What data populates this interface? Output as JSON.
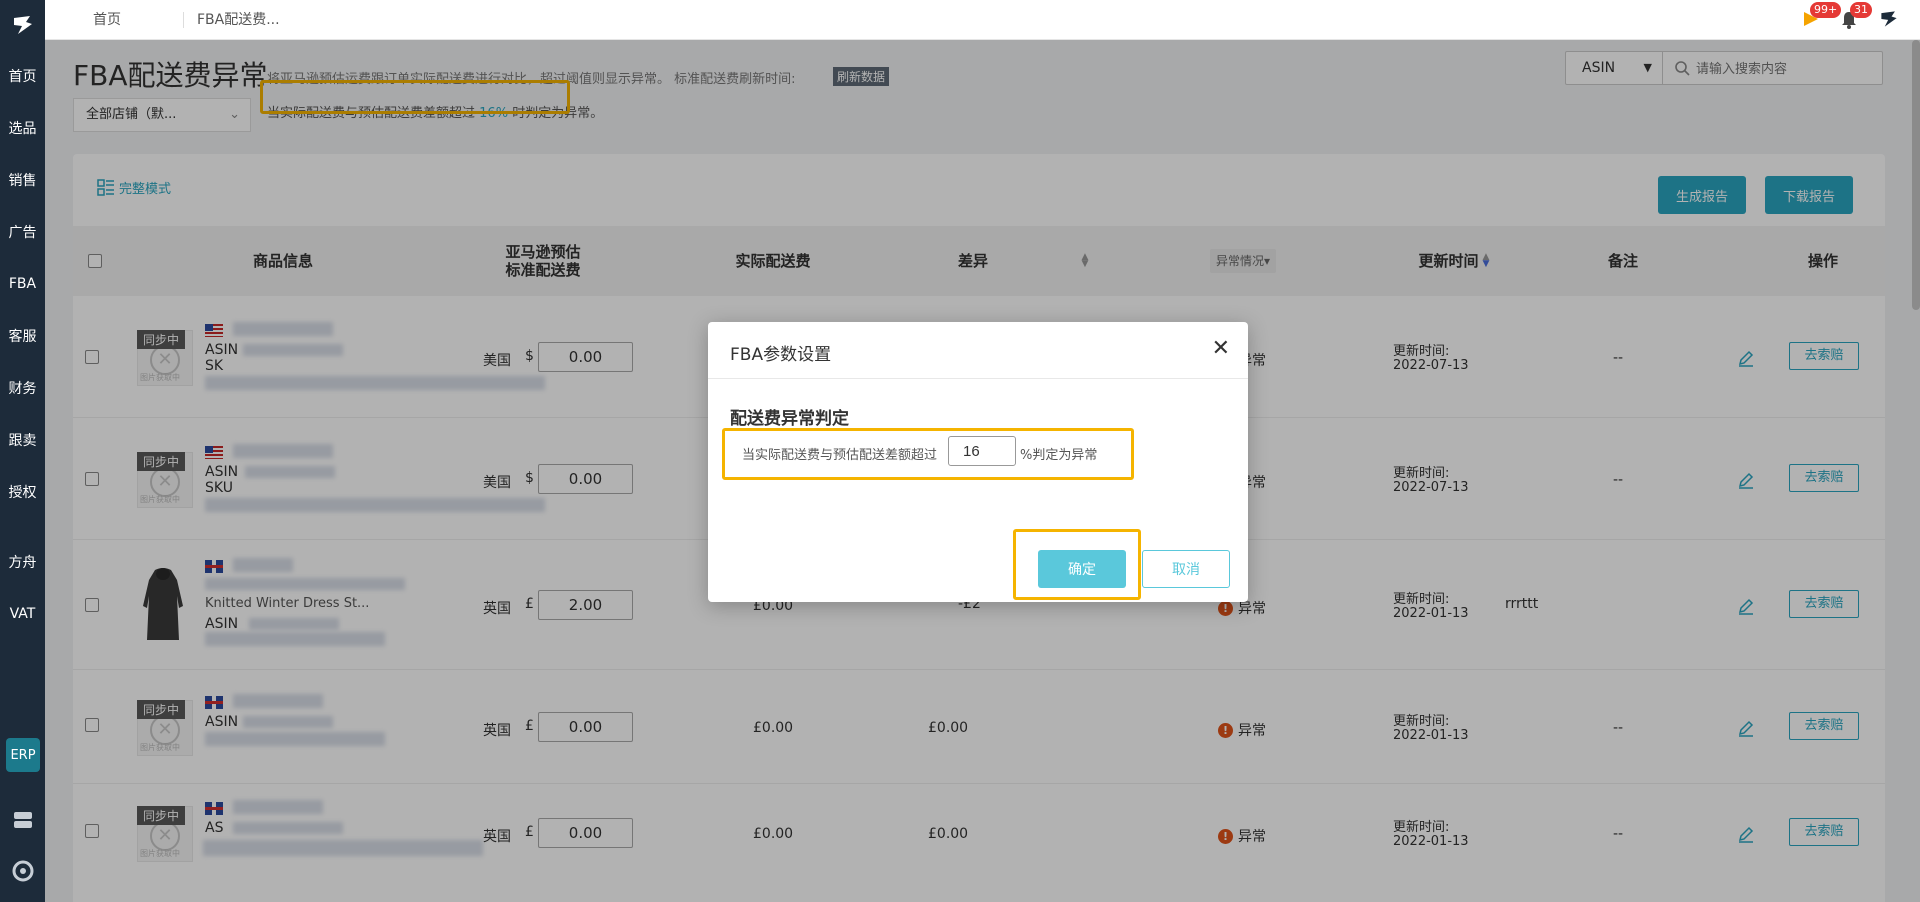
{
  "sidebar": {
    "items": [
      "首页",
      "选品",
      "销售",
      "广告",
      "FBA",
      "客服",
      "财务",
      "跟卖",
      "授权",
      "方舟",
      "VAT"
    ],
    "erp": "ERP"
  },
  "topbar": {
    "tabs": [
      "首页",
      "FBA配送费..."
    ],
    "flag_badge": "99+",
    "bell_badge": "31"
  },
  "page": {
    "title": "FBA配送费异常",
    "description": "将亚马逊预估运费跟订单实际配送费进行对比，超过阈值则显示异常。 标准配送费刷新时间:",
    "refresh_label": "刷新数据",
    "store_select": "全部店铺（默...",
    "hint_prefix": "当实际配送费与预估配送费差额超过",
    "hint_pct": "16%",
    "hint_suffix": "时判定为异常。"
  },
  "search": {
    "field": "ASIN",
    "placeholder": "请输入搜索内容"
  },
  "toolbar": {
    "mode_label": "完整模式",
    "generate_report": "生成报告",
    "download_report": "下载报告"
  },
  "table": {
    "headers": {
      "product": "商品信息",
      "amazon_fee_1": "亚马逊预估",
      "amazon_fee_2": "标准配送费",
      "actual_fee": "实际配送费",
      "diff": "差异",
      "status_filter": "异常情况▾",
      "updated": "更新时间",
      "remark": "备注",
      "action": "操作"
    },
    "rows": [
      {
        "sync": "同步中",
        "asin_label": "ASIN",
        "sku_label": "SK",
        "country": "美国",
        "currency": "$",
        "amazon_fee": "0.00",
        "actual": "",
        "diff": "",
        "status": "异常",
        "updated_label": "更新时间:",
        "updated_date": "2022-07-13",
        "remark": "--",
        "op": "去索赔"
      },
      {
        "sync": "同步中",
        "asin_label": "ASIN",
        "sku_label": "SKU",
        "country": "美国",
        "currency": "$",
        "amazon_fee": "0.00",
        "actual": "",
        "diff": "",
        "status": "异常",
        "updated_label": "更新时间:",
        "updated_date": "2022-07-13",
        "remark": "--",
        "op": "去索赔"
      },
      {
        "sync": "",
        "asin_label": "ASIN",
        "product_name": "Knitted Winter Dress St...",
        "country": "英国",
        "currency": "£",
        "amazon_fee": "2.00",
        "actual": "£0.00",
        "diff": "-£2",
        "status": "异常",
        "updated_label": "更新时间:",
        "updated_date": "2022-01-13",
        "remark": "rrrttt",
        "op": "去索赔"
      },
      {
        "sync": "同步中",
        "asin_label": "ASIN",
        "country": "英国",
        "currency": "£",
        "amazon_fee": "0.00",
        "actual": "£0.00",
        "diff": "£0.00",
        "status": "异常",
        "updated_label": "更新时间:",
        "updated_date": "2022-01-13",
        "remark": "--",
        "op": "去索赔"
      },
      {
        "sync": "同步中",
        "asin_label": "AS",
        "country": "英国",
        "currency": "£",
        "amazon_fee": "0.00",
        "actual": "£0.00",
        "diff": "£0.00",
        "status": "异常",
        "updated_label": "更新时间:",
        "updated_date": "2022-01-13",
        "remark": "--",
        "op": "去索赔"
      }
    ],
    "placeholder_caption": "图片获取中"
  },
  "modal": {
    "title": "FBA参数设置",
    "section": "配送费异常判定",
    "text_prefix": "当实际配送费与预估配送差额超过",
    "value": "16",
    "text_suffix": "%判定为异常",
    "ok": "确定",
    "cancel": "取消"
  },
  "colors": {
    "accent": "#2aa5c0",
    "highlight": "#f5b400",
    "sidebar": "#1d2b3a",
    "status_dot": "#e0541a"
  }
}
